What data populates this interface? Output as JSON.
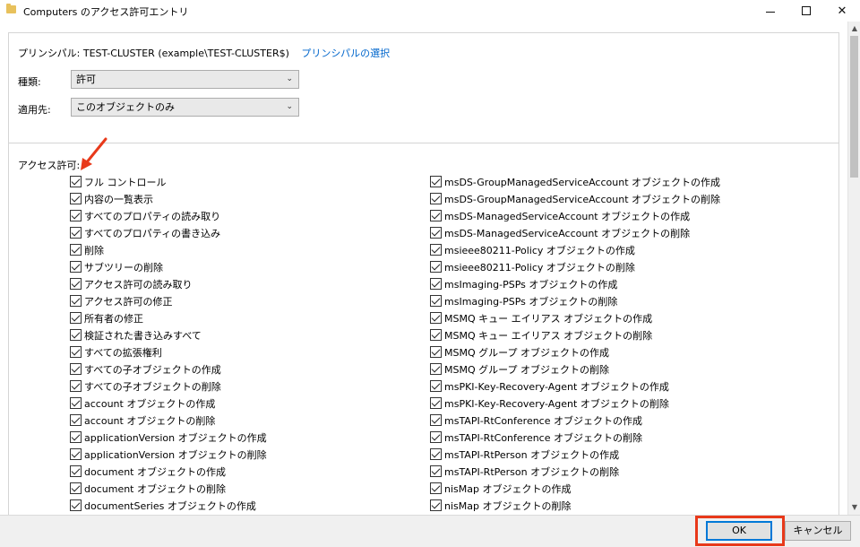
{
  "window": {
    "title": "Computers のアクセス許可エントリ",
    "minimize": "—",
    "maximize": "☐",
    "close": "✕"
  },
  "principal": {
    "label": "プリンシパル:",
    "value": "TEST-CLUSTER (example\\TEST-CLUSTER$)",
    "select_link": "プリンシパルの選択"
  },
  "type_field": {
    "label": "種類:",
    "value": "許可"
  },
  "applies_field": {
    "label": "適用先:",
    "value": "このオブジェクトのみ"
  },
  "permissions": {
    "label": "アクセス許可:",
    "left": [
      "フル コントロール",
      "内容の一覧表示",
      "すべてのプロパティの読み取り",
      "すべてのプロパティの書き込み",
      "削除",
      "サブツリーの削除",
      "アクセス許可の読み取り",
      "アクセス許可の修正",
      "所有者の修正",
      "検証された書き込みすべて",
      "すべての拡張権利",
      "すべての子オブジェクトの作成",
      "すべての子オブジェクトの削除",
      "account オブジェクトの作成",
      "account オブジェクトの削除",
      "applicationVersion オブジェクトの作成",
      "applicationVersion オブジェクトの削除",
      "document オブジェクトの作成",
      "document オブジェクトの削除",
      "documentSeries オブジェクトの作成"
    ],
    "right": [
      "msDS-GroupManagedServiceAccount オブジェクトの作成",
      "msDS-GroupManagedServiceAccount オブジェクトの削除",
      "msDS-ManagedServiceAccount オブジェクトの作成",
      "msDS-ManagedServiceAccount オブジェクトの削除",
      "msieee80211-Policy オブジェクトの作成",
      "msieee80211-Policy オブジェクトの削除",
      "msImaging-PSPs オブジェクトの作成",
      "msImaging-PSPs オブジェクトの削除",
      "MSMQ キュー エイリアス オブジェクトの作成",
      "MSMQ キュー エイリアス オブジェクトの削除",
      "MSMQ グループ オブジェクトの作成",
      "MSMQ グループ オブジェクトの削除",
      "msPKI-Key-Recovery-Agent オブジェクトの作成",
      "msPKI-Key-Recovery-Agent オブジェクトの削除",
      "msTAPI-RtConference オブジェクトの作成",
      "msTAPI-RtConference オブジェクトの削除",
      "msTAPI-RtPerson オブジェクトの作成",
      "msTAPI-RtPerson オブジェクトの削除",
      "nisMap オブジェクトの作成",
      "nisMap オブジェクトの削除"
    ]
  },
  "buttons": {
    "ok": "OK",
    "cancel": "キャンセル"
  },
  "icons": {
    "folder": "folder-icon",
    "dropdown": "chevron-down-icon",
    "annotation": "arrow-icon"
  },
  "colors": {
    "annotation": "#e8391a",
    "link": "#0066cc",
    "default_button_border": "#0078d7"
  }
}
